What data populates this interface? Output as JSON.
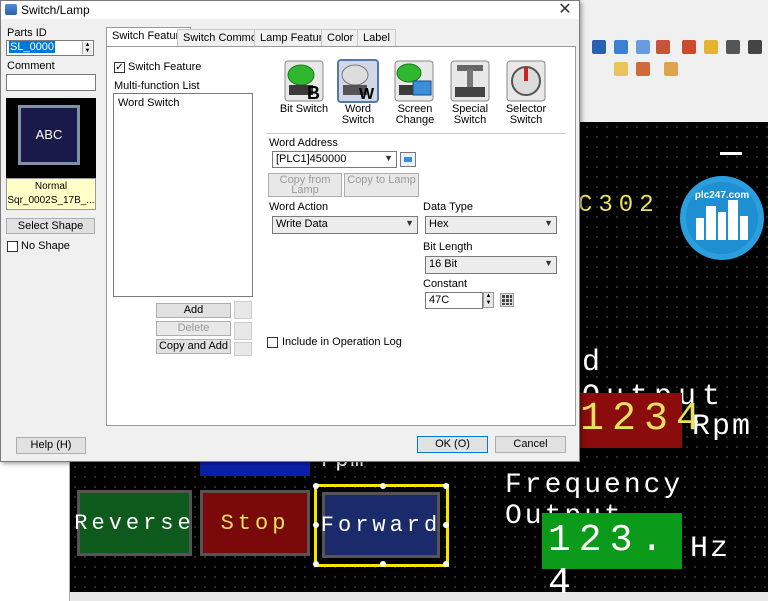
{
  "dialog": {
    "title": "Switch/Lamp",
    "close_glyph": "✕"
  },
  "left": {
    "parts_id_label": "Parts ID",
    "parts_id_value": "SL_0000",
    "comment_label": "Comment",
    "comment_value": "",
    "preview_text": "ABC",
    "preview_state": "Normal",
    "preview_shape": "Sqr_0002S_17B_...",
    "select_shape_label": "Select Shape",
    "no_shape_label": "No Shape",
    "help_label": "Help (H)"
  },
  "tabs": [
    "Switch Feature",
    "Switch Common",
    "Lamp Feature",
    "Color",
    "Label"
  ],
  "switch_feature": {
    "enable_label": "Switch Feature",
    "enable_checked": true,
    "list_label": "Multi-function List",
    "list_items": [
      "Word Switch"
    ],
    "add_label": "Add",
    "delete_label": "Delete",
    "copy_add_label": "Copy and Add",
    "switch_types": [
      {
        "label1": "Bit Switch",
        "label2": ""
      },
      {
        "label1": "Word",
        "label2": "Switch"
      },
      {
        "label1": "Screen",
        "label2": "Change"
      },
      {
        "label1": "Special",
        "label2": "Switch"
      },
      {
        "label1": "Selector",
        "label2": "Switch"
      }
    ],
    "word_address_label": "Word Address",
    "word_address_value": "[PLC1]450000",
    "copy_from_lamp": "Copy from Lamp",
    "copy_to_lamp": "Copy to Lamp",
    "word_action_label": "Word Action",
    "word_action_value": "Write Data",
    "data_type_label": "Data Type",
    "data_type_value": "Hex",
    "bit_length_label": "Bit Length",
    "bit_length_value": "16 Bit",
    "constant_label": "Constant",
    "constant_value": "47C",
    "include_log_label": "Include in Operation Log"
  },
  "buttons": {
    "ok": "OK (O)",
    "cancel": "Cancel"
  },
  "screen": {
    "logo_text": "plc247.com",
    "c302": "C302",
    "speed_output_label": "d Output",
    "speed_value": "1234",
    "rpm_unit": "Rpm",
    "small_rpm": "rpm",
    "freq_label": "Frequency Output",
    "freq_value": "123. 4",
    "hz_unit": "Hz",
    "reverse": "Reverse",
    "stop": "Stop",
    "forward": "Forward"
  }
}
